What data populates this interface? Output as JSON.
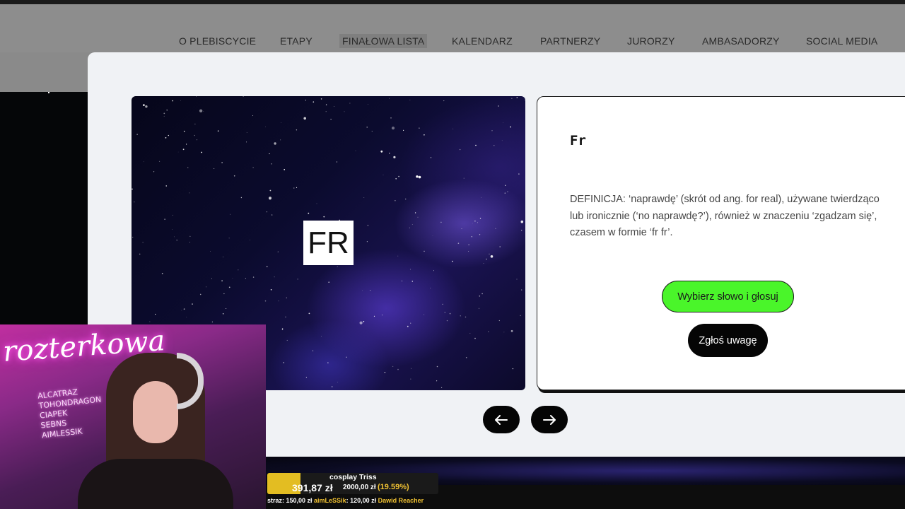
{
  "nav": {
    "items": [
      "O PLEBISCYCIE",
      "ETAPY",
      "FINAŁOWA LISTA",
      "KALENDARZ",
      "PARTNERZY",
      "JURORZY",
      "AMBASADORZY",
      "SOCIAL MEDIA"
    ],
    "active": "FINAŁOWA LISTA"
  },
  "slide": {
    "image_word": "FR",
    "word_title": "Fr",
    "definition": "DEFINICJA: ‘naprawdę’ (skrót od ang. for real), używane twierdząco lub ironicznie (‘no naprawdę?’), również w znaczeniu ‘zgadzam się’, czasem w formie ‘fr fr’.",
    "vote_label": "Wybierz słowo i głosuj",
    "report_label": "Zgłoś uwagę",
    "vote_color": "#4af52a"
  },
  "carousel": {
    "prev_icon": "arrow-left-icon",
    "next_icon": "arrow-right-icon"
  },
  "stream": {
    "neon_sign": "rozterkowa",
    "neon_names": [
      "ALCATRAZ",
      "TOHONDRAGON",
      "CIAPEK",
      "SEBNS",
      "AIMLESSIK"
    ],
    "goal_title": "cosplay Triss",
    "goal_amount": "391,87 zł",
    "goal_target": "2000,00 zł",
    "goal_percent": "(19.59%)",
    "goal_progress": 0.1959,
    "goal_color": "#e3bd22",
    "ticker": [
      {
        "name": "",
        "text": "straz: 150,00 zł "
      },
      {
        "name": "aimLeSSik",
        "text": ": 120,00 zł "
      },
      {
        "name": "Dawid Reacher",
        "text": ""
      }
    ]
  }
}
